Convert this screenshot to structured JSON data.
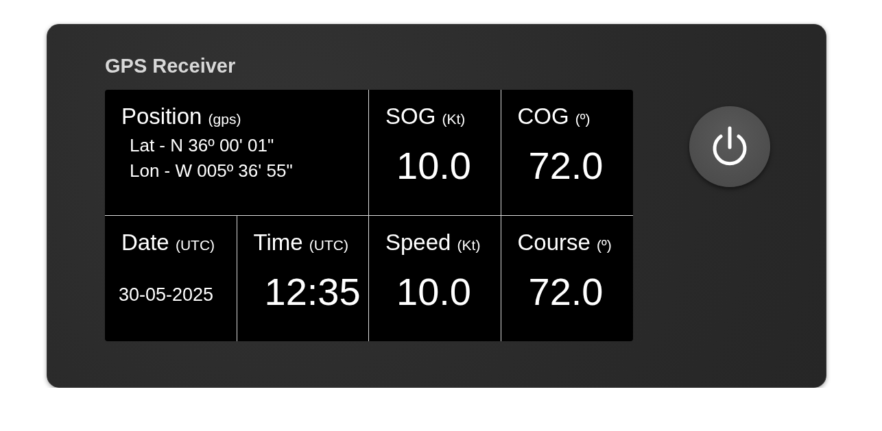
{
  "title": "GPS Receiver",
  "cells": [
    {
      "kind": "position",
      "label": "Position",
      "unit": "(gps)",
      "lines": [
        "Lat - N 36º 00' 01\"",
        "Lon - W 005º 36' 55\""
      ]
    },
    {
      "kind": "reading",
      "label": "SOG",
      "unit": "(Kt)",
      "value": "10.0"
    },
    {
      "kind": "reading",
      "label": "COG",
      "unit": "(º)",
      "value": "72.0"
    },
    {
      "kind": "date",
      "label": "Date",
      "unit": "(UTC)",
      "value": "30-05-2025"
    },
    {
      "kind": "reading",
      "label": "Time",
      "unit": "(UTC)",
      "value": "12:35"
    },
    {
      "kind": "reading",
      "label": "Speed",
      "unit": "(Kt)",
      "value": "10.0"
    },
    {
      "kind": "reading",
      "label": "Course",
      "unit": "(º)",
      "value": "72.0"
    }
  ]
}
